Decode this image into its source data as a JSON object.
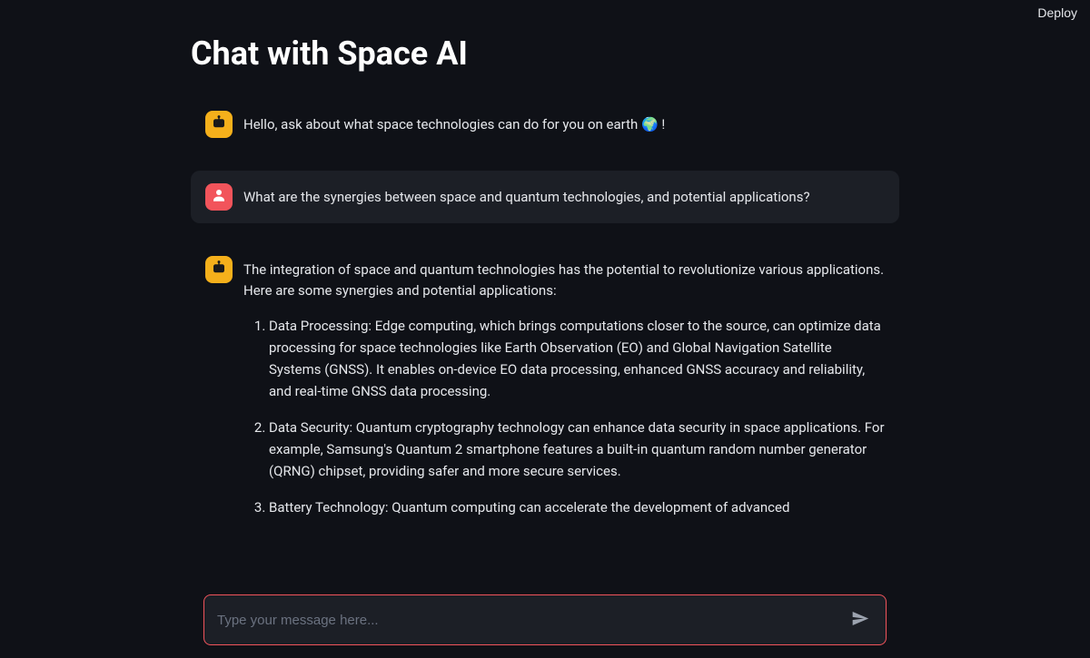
{
  "header": {
    "deploy_label": "Deploy"
  },
  "page": {
    "title": "Chat with Space AI"
  },
  "messages": [
    {
      "role": "bot",
      "text": "Hello, ask about what space technologies can do for you on earth 🌍 !"
    },
    {
      "role": "user",
      "text": "What are the synergies between space and quantum technologies, and potential applications?"
    },
    {
      "role": "bot",
      "intro": "The integration of space and quantum technologies has the potential to revolutionize various applications. Here are some synergies and potential applications:",
      "list": [
        "Data Processing: Edge computing, which brings computations closer to the source, can optimize data processing for space technologies like Earth Observation (EO) and Global Navigation Satellite Systems (GNSS). It enables on-device EO data processing, enhanced GNSS accuracy and reliability, and real-time GNSS data processing.",
        "Data Security: Quantum cryptography technology can enhance data security in space applications. For example, Samsung's Quantum 2 smartphone features a built-in quantum random number generator (QRNG) chipset, providing safer and more secure services.",
        "Battery Technology: Quantum computing can accelerate the development of advanced"
      ]
    }
  ],
  "input": {
    "placeholder": "Type your message here...",
    "value": ""
  }
}
